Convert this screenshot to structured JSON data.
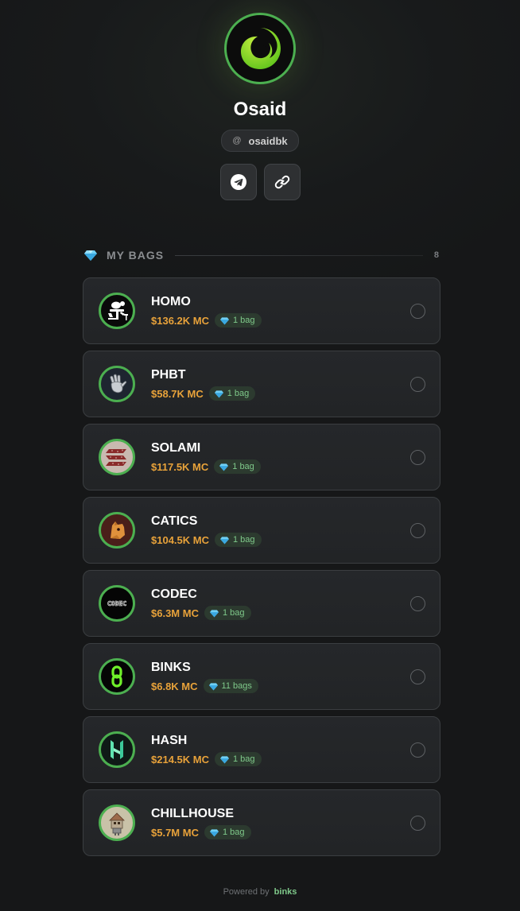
{
  "profile": {
    "name": "Osaid",
    "handle_prefix": "@",
    "handle": "osaidbk",
    "avatar_icon": "green-swirl-logo",
    "socials": [
      {
        "icon": "telegram-icon"
      },
      {
        "icon": "link-icon"
      }
    ]
  },
  "section": {
    "icon": "diamond-icon",
    "title": "MY BAGS",
    "count": "8"
  },
  "bags": [
    {
      "name": "HOMO",
      "mc": "$136.2K MC",
      "badge": "1 bag",
      "logo": "homo-logo"
    },
    {
      "name": "PHBT",
      "mc": "$58.7K MC",
      "badge": "1 bag",
      "logo": "phbt-logo"
    },
    {
      "name": "SOLAMI",
      "mc": "$117.5K MC",
      "badge": "1 bag",
      "logo": "solami-logo"
    },
    {
      "name": "CATICS",
      "mc": "$104.5K MC",
      "badge": "1 bag",
      "logo": "catics-logo"
    },
    {
      "name": "CODEC",
      "mc": "$6.3M MC",
      "badge": "1 bag",
      "logo": "codec-logo",
      "logo_text": "CODEC"
    },
    {
      "name": "BINKS",
      "mc": "$6.8K MC",
      "badge": "11 bags",
      "logo": "binks-logo"
    },
    {
      "name": "HASH",
      "mc": "$214.5K MC",
      "badge": "1 bag",
      "logo": "hash-logo"
    },
    {
      "name": "CHILLHOUSE",
      "mc": "$5.7M MC",
      "badge": "1 bag",
      "logo": "chillhouse-logo"
    }
  ],
  "footer": {
    "prefix": "Powered by",
    "brand": "binks"
  },
  "colors": {
    "background": "#181a1b",
    "accent_green": "#4caf50",
    "market_cap": "#e8a23a",
    "badge_text": "#7fc98a"
  }
}
